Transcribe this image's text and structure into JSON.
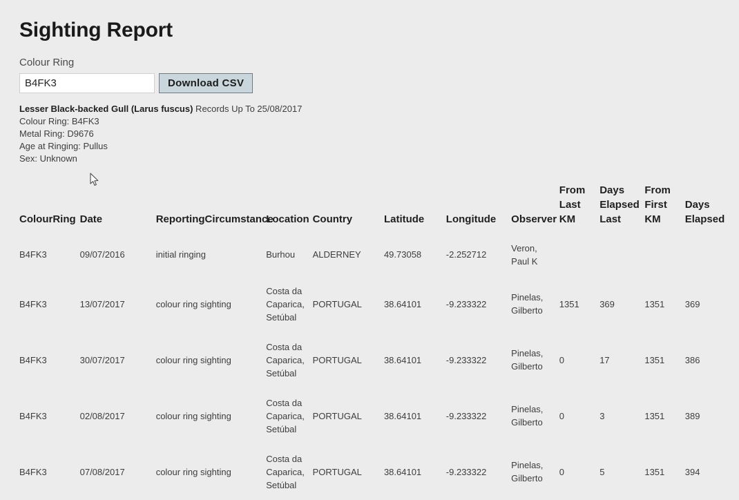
{
  "page": {
    "title": "Sighting Report"
  },
  "search": {
    "label": "Colour Ring",
    "input_value": "B4FK3",
    "input_placeholder": "",
    "download_label": "Download CSV"
  },
  "meta": {
    "species": "Lesser Black-backed Gull (Larus fuscus)",
    "records_up_to": " Records Up To 25/08/2017",
    "colour_ring": "Colour Ring: B4FK3",
    "metal_ring": "Metal Ring: D9676",
    "age_at_ringing": "Age at Ringing: Pullus",
    "sex": "Sex: Unknown"
  },
  "table": {
    "headers": {
      "colour_ring": "ColourRing",
      "date": "Date",
      "reporting_circumstance": "ReportingCircumstance",
      "location": "Location",
      "country": "Country",
      "latitude": "Latitude",
      "longitude": "Longitude",
      "observer": "Observer",
      "from_last_km": "From Last KM",
      "days_elapsed_last": "Days Elapsed Last",
      "from_first_km": "From First KM",
      "days_elapsed": "Days Elapsed"
    },
    "rows": [
      {
        "colour_ring": "B4FK3",
        "date": "09/07/2016",
        "reporting_circumstance": "initial ringing",
        "location": "Burhou",
        "country": "ALDERNEY",
        "latitude": "49.73058",
        "longitude": "-2.252712",
        "observer": "Veron, Paul K",
        "from_last_km": "",
        "days_elapsed_last": "",
        "from_first_km": "",
        "days_elapsed": ""
      },
      {
        "colour_ring": "B4FK3",
        "date": "13/07/2017",
        "reporting_circumstance": "colour ring sighting",
        "location": "Costa da Caparica, Setúbal",
        "country": "PORTUGAL",
        "latitude": "38.64101",
        "longitude": "-9.233322",
        "observer": "Pinelas, Gilberto",
        "from_last_km": "1351",
        "days_elapsed_last": "369",
        "from_first_km": "1351",
        "days_elapsed": "369"
      },
      {
        "colour_ring": "B4FK3",
        "date": "30/07/2017",
        "reporting_circumstance": "colour ring sighting",
        "location": "Costa da Caparica, Setúbal",
        "country": "PORTUGAL",
        "latitude": "38.64101",
        "longitude": "-9.233322",
        "observer": "Pinelas, Gilberto",
        "from_last_km": "0",
        "days_elapsed_last": "17",
        "from_first_km": "1351",
        "days_elapsed": "386"
      },
      {
        "colour_ring": "B4FK3",
        "date": "02/08/2017",
        "reporting_circumstance": "colour ring sighting",
        "location": "Costa da Caparica, Setúbal",
        "country": "PORTUGAL",
        "latitude": "38.64101",
        "longitude": "-9.233322",
        "observer": "Pinelas, Gilberto",
        "from_last_km": "0",
        "days_elapsed_last": "3",
        "from_first_km": "1351",
        "days_elapsed": "389"
      },
      {
        "colour_ring": "B4FK3",
        "date": "07/08/2017",
        "reporting_circumstance": "colour ring sighting",
        "location": "Costa da Caparica, Setúbal",
        "country": "PORTUGAL",
        "latitude": "38.64101",
        "longitude": "-9.233322",
        "observer": "Pinelas, Gilberto",
        "from_last_km": "0",
        "days_elapsed_last": "5",
        "from_first_km": "1351",
        "days_elapsed": "394"
      }
    ]
  },
  "colors": {
    "background": "#ececec",
    "button": "#c9d6dc",
    "button_border": "#6d7b82",
    "text": "#3d3d3d",
    "heading": "#1a1a1a"
  }
}
